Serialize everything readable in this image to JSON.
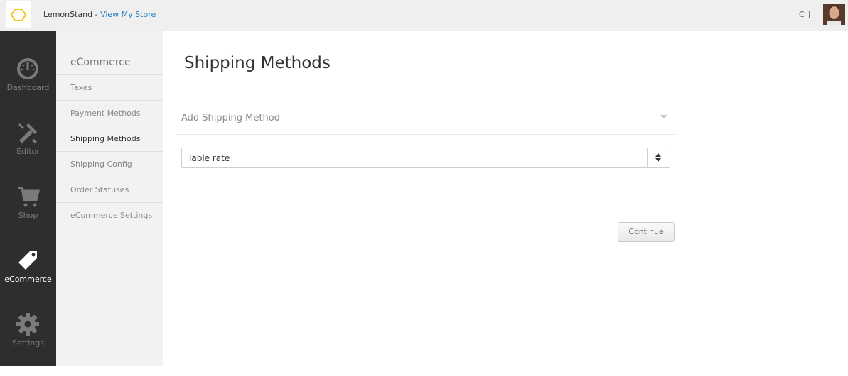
{
  "header": {
    "store_name": "LemonStand - ",
    "store_link": "View My Store",
    "user_initials": "C J"
  },
  "leftnav": {
    "items": [
      {
        "label": "Dashboard",
        "icon": "gauge-icon"
      },
      {
        "label": "Editor",
        "icon": "tools-icon"
      },
      {
        "label": "Shop",
        "icon": "cart-icon"
      },
      {
        "label": "eCommerce",
        "icon": "tag-icon",
        "active": true
      },
      {
        "label": "Settings",
        "icon": "gear-icon"
      }
    ]
  },
  "subnav": {
    "title": "eCommerce",
    "items": [
      {
        "label": "Taxes"
      },
      {
        "label": "Payment Methods"
      },
      {
        "label": "Shipping Methods",
        "active": true
      },
      {
        "label": "Shipping Config"
      },
      {
        "label": "Order Statuses"
      },
      {
        "label": "eCommerce Settings"
      }
    ]
  },
  "main": {
    "title": "Shipping Methods",
    "add_method_label": "Add Shipping Method",
    "select_value": "Table rate",
    "continue_label": "Continue"
  },
  "colors": {
    "link": "#1d7ec6",
    "nav_bg": "#2e2e2e",
    "logo_accent": "#f0c419"
  }
}
